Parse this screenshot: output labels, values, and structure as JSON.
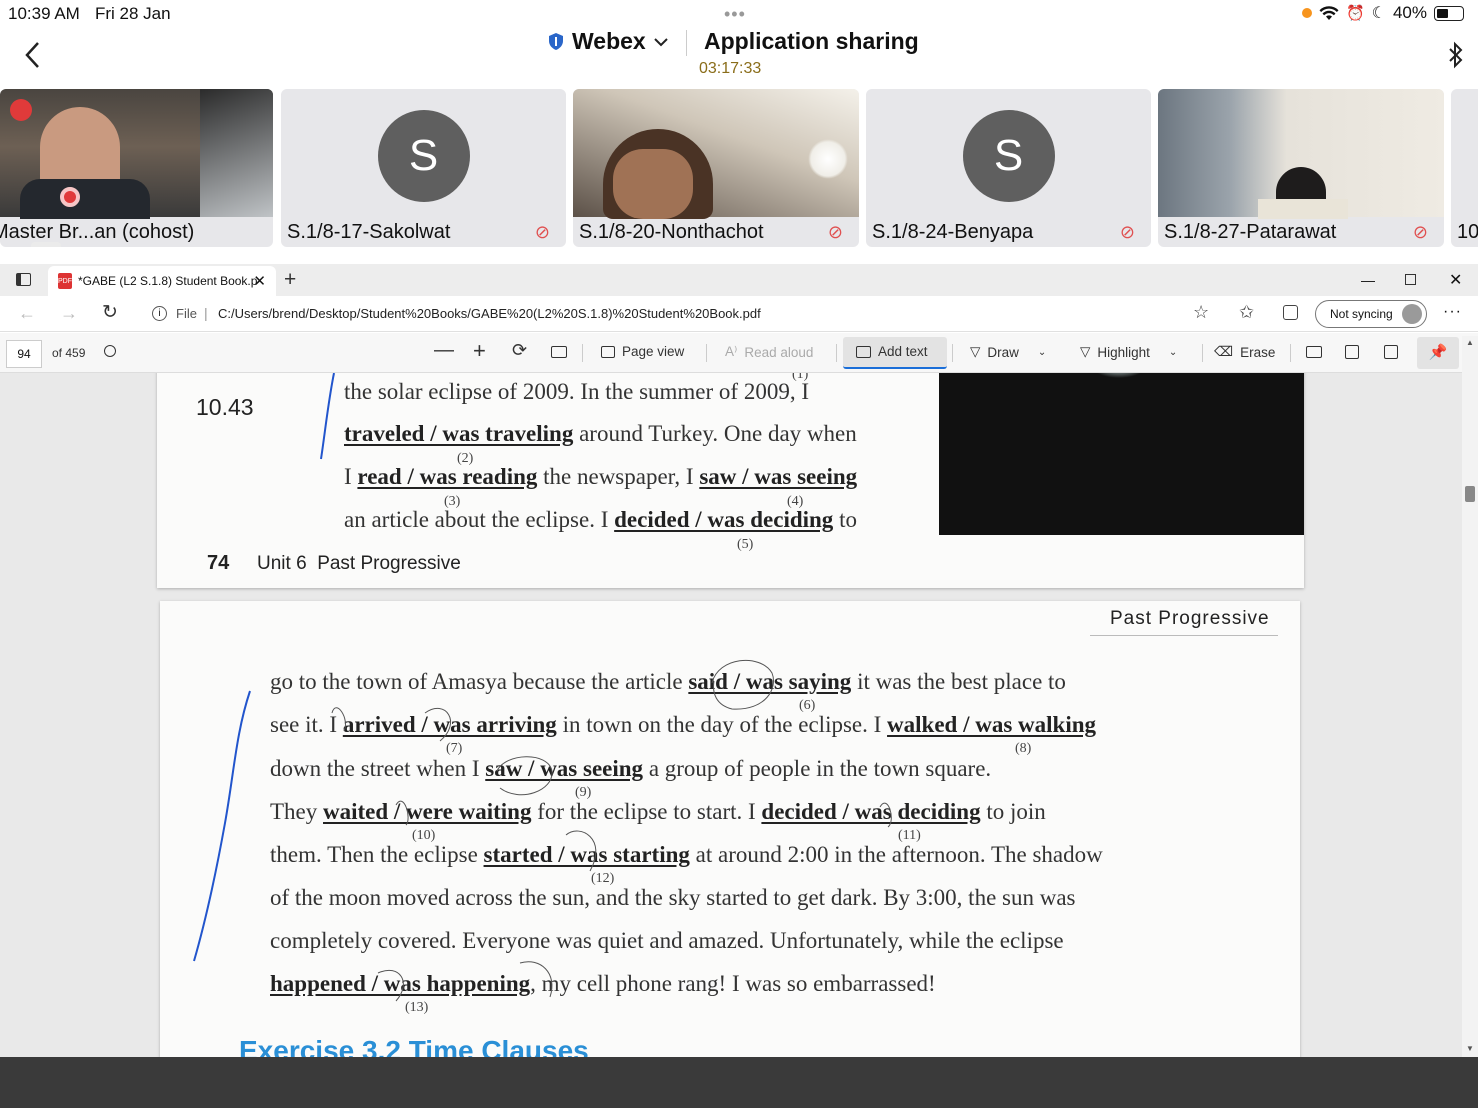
{
  "status": {
    "time": "10:39 AM",
    "date": "Fri 28 Jan",
    "battery": "40%"
  },
  "webex": {
    "app": "Webex",
    "title": "Application sharing",
    "timer": "03:17:33"
  },
  "tiles": [
    {
      "name": "Master Br...an (cohost)",
      "type": "video"
    },
    {
      "name": "S.1/8-17-Sakolwat",
      "initial": "S",
      "type": "avatar"
    },
    {
      "name": "S.1/8-20-Nonthachot",
      "type": "video"
    },
    {
      "name": "S.1/8-24-Benyapa",
      "initial": "S",
      "type": "avatar"
    },
    {
      "name": "S.1/8-27-Patarawat",
      "type": "video"
    },
    {
      "name": "10",
      "type": "partial"
    }
  ],
  "browser": {
    "tab_title": "*GABE (L2 S.1.8) Student Book.p",
    "url_scheme": "File",
    "url": "C:/Users/brend/Desktop/Student%20Books/GABE%20(L2%20S.1.8)%20Student%20Book.pdf",
    "sync": "Not syncing"
  },
  "pdf": {
    "page": "94",
    "of": "of 459",
    "tools": {
      "page_view": "Page view",
      "read_aloud": "Read aloud",
      "add_text": "Add text",
      "draw": "Draw",
      "highlight": "Highlight",
      "erase": "Erase"
    }
  },
  "page1": {
    "track": "10.43",
    "lines": [
      {
        "pre": "the solar eclipse of 2009. In the summer of 2009, I",
        "b": "",
        "post": ""
      },
      {
        "pre": "",
        "b": "traveled / was traveling",
        "post": " around Turkey. One day when"
      },
      {
        "pre": "I ",
        "b": "read / was reading",
        "post": " the newspaper, I "
      },
      {
        "pre": "an article about the eclipse. I ",
        "b": "decided / was deciding",
        "post": " to"
      }
    ],
    "extra_b3": "saw / was seeing",
    "nums": [
      "(1)",
      "(2)",
      "(3)",
      "(4)",
      "(5)"
    ],
    "footer_num": "74",
    "footer_text": "Unit 6  Past Progressive"
  },
  "page2": {
    "header": "Past Progressive",
    "l1": [
      "go to the town of Amasya because the article ",
      "said / was saying",
      " it was the best place to"
    ],
    "l2": [
      "see it. I ",
      "arrived / was arriving",
      " in town on the day of the eclipse. I ",
      "walked / was walking"
    ],
    "l3": [
      "down the street when I ",
      "saw / was seeing",
      " a group of people in the town square."
    ],
    "l4": [
      "They ",
      "waited / were waiting",
      " for the eclipse to start. I ",
      "decided / was deciding",
      " to join"
    ],
    "l5": [
      "them. Then the eclipse ",
      "started / was starting",
      " at around 2:00 in the afternoon. The shadow"
    ],
    "l6": "of the moon moved across the sun, and the sky started to get dark. By 3:00, the sun was",
    "l7": "completely covered. Everyone was quiet and amazed. Unfortunately, while the eclipse",
    "l8": [
      "happened / was happening",
      ", my cell phone rang! I was so embarrassed!"
    ],
    "nums": [
      "(6)",
      "(7)",
      "(8)",
      "(9)",
      "(10)",
      "(11)",
      "(12)",
      "(13)"
    ],
    "next_heading": "Exercise 3.2 Time Clauses"
  }
}
